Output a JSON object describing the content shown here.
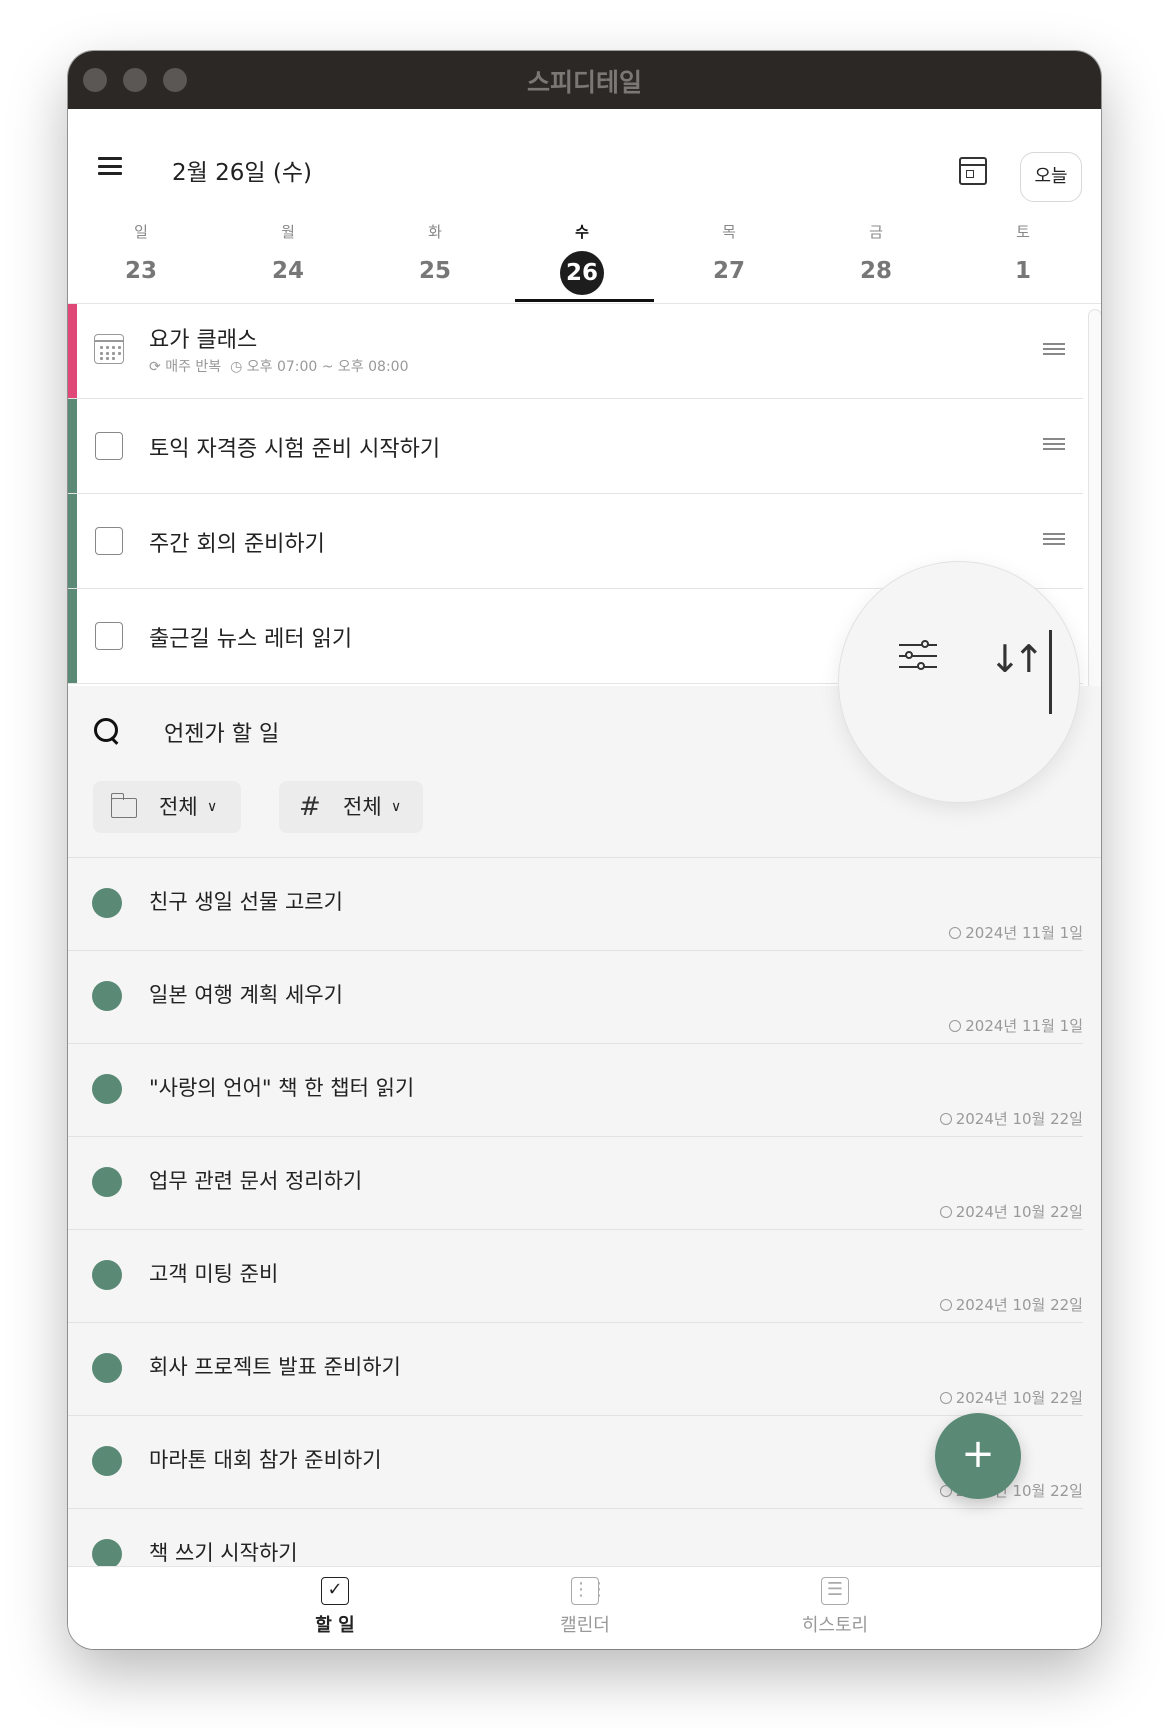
{
  "app": {
    "title": "스피디테일"
  },
  "header": {
    "date": "2월 26일 (수)",
    "today_label": "오늘"
  },
  "week": [
    {
      "name": "일",
      "num": "23"
    },
    {
      "name": "월",
      "num": "24"
    },
    {
      "name": "화",
      "num": "25"
    },
    {
      "name": "수",
      "num": "26",
      "selected": true
    },
    {
      "name": "목",
      "num": "27"
    },
    {
      "name": "금",
      "num": "28"
    },
    {
      "name": "토",
      "num": "1"
    }
  ],
  "tasks": [
    {
      "title": "요가 클래스",
      "type": "event",
      "color": "#e0487a",
      "repeat": "매주 반복",
      "time": "오후 07:00 ~ 오후 08:00"
    },
    {
      "title": "토익 자격증 시험 준비 시작하기",
      "type": "todo",
      "color": "#5a8a76"
    },
    {
      "title": "주간 회의 준비하기",
      "type": "todo",
      "color": "#5a8a76"
    },
    {
      "title": "출근길 뉴스 레터 읽기",
      "type": "todo",
      "color": "#5a8a76"
    }
  ],
  "someday": {
    "title": "언젠가 할 일",
    "folder_filter": "전체",
    "tag_filter": "전체",
    "items": [
      {
        "title": "친구 생일 선물 고르기",
        "date": "2024년 11월 1일"
      },
      {
        "title": "일본 여행 계획 세우기",
        "date": "2024년 11월 1일"
      },
      {
        "title": "\"사랑의 언어\" 책 한 챕터 읽기",
        "date": "2024년 10월 22일"
      },
      {
        "title": "업무 관련 문서 정리하기",
        "date": "2024년 10월 22일"
      },
      {
        "title": "고객 미팅 준비",
        "date": "2024년 10월 22일"
      },
      {
        "title": "회사 프로젝트 발표 준비하기",
        "date": "2024년 10월 22일"
      },
      {
        "title": "마라톤 대회 참가 준비하기",
        "date": "2024년 10월 22일"
      },
      {
        "title": "책 쓰기 시작하기",
        "date": ""
      }
    ]
  },
  "fab": {
    "label": "+"
  },
  "bottom_nav": [
    {
      "label": "할 일",
      "active": true,
      "icon": "checkbox-icon"
    },
    {
      "label": "캘린더",
      "active": false,
      "icon": "calendar-icon"
    },
    {
      "label": "히스토리",
      "active": false,
      "icon": "history-icon"
    }
  ],
  "colors": {
    "accent": "#5a8a76",
    "event": "#e0487a",
    "titlebar": "#2b2826"
  }
}
